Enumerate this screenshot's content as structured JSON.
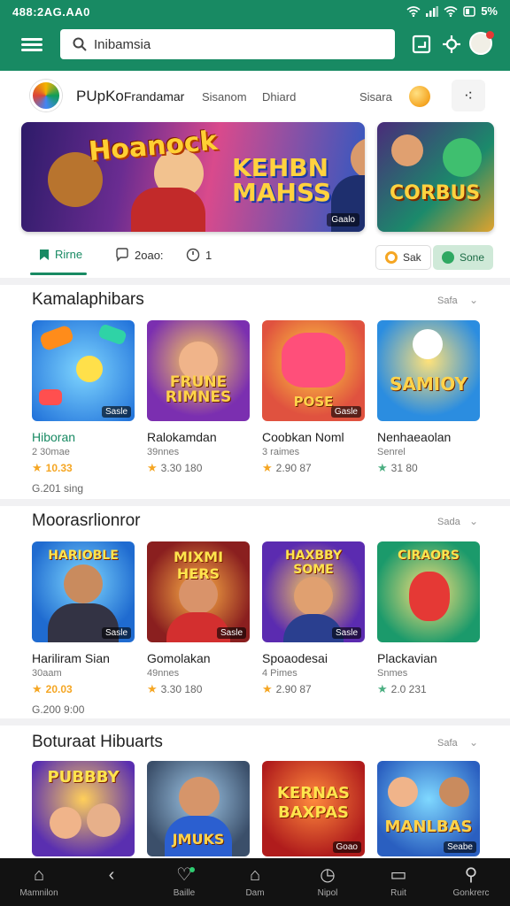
{
  "status_bar": {
    "time": "488:2AG.AA0",
    "battery": "5%"
  },
  "search": {
    "query": "Inibamsia"
  },
  "brand_row": {
    "brand": "PUpKo",
    "nav": [
      "Frandamar",
      "Sisanom",
      "Dhiard",
      "Sisara"
    ]
  },
  "banners": [
    {
      "title_top": "Hoanock",
      "title_main": "KEHBN MAHSS",
      "badge": "Gaalo"
    },
    {
      "title": "CORBUS"
    }
  ],
  "tabs": [
    {
      "label": "Rirne",
      "icon": "bookmark-icon",
      "active": true
    },
    {
      "label": "2oao:",
      "icon": "chat-icon",
      "active": false
    },
    {
      "label": "1",
      "icon": "clock-icon",
      "active": false
    }
  ],
  "chips": [
    {
      "label": "Sak"
    },
    {
      "label": "Sone"
    }
  ],
  "sections": [
    {
      "title": "Kamalaphibars",
      "more": "Safa",
      "cards": [
        {
          "name": "Hiboran",
          "sub": "2 30mae",
          "rating": "10.33",
          "extra": "G.201 sing",
          "badge": "Sasle",
          "art_text": "",
          "art_top": "",
          "name_green": true
        },
        {
          "name": "Ralokamdan",
          "sub": "39nnes",
          "rating": "3.30 180",
          "extra": "",
          "badge": "",
          "art_text": "FRUNE RIMNES",
          "art_top": "",
          "name_green": false
        },
        {
          "name": "Coobkan Noml",
          "sub": "3 raimes",
          "rating": "2.90 87",
          "extra": "",
          "badge": "Gasle",
          "art_text": "POSE",
          "art_top": "",
          "name_green": false
        },
        {
          "name": "Nenhaeaolan",
          "sub": "Senrel",
          "rating": "31 80",
          "extra": "",
          "badge": "",
          "art_text": "SAMIOY",
          "art_top": "",
          "name_green": false
        }
      ]
    },
    {
      "title": "Moorasrlionror",
      "more": "Sada",
      "cards": [
        {
          "name": "Hariliram Sian",
          "sub": "30aam",
          "rating": "20.03",
          "extra": "G.200 9:00",
          "badge": "Sasle",
          "art_text": "",
          "art_top": "HARIOBLE",
          "name_green": false
        },
        {
          "name": "Gomolakan",
          "sub": "49nnes",
          "rating": "3.30 180",
          "extra": "",
          "badge": "Sasle",
          "art_text": "",
          "art_top": "MIXMI HERS",
          "name_green": false
        },
        {
          "name": "Spoaodesai",
          "sub": "4 Pimes",
          "rating": "2.90 87",
          "extra": "",
          "badge": "Sasle",
          "art_text": "",
          "art_top": "HAXBBY SOME",
          "name_green": false
        },
        {
          "name": "Plackavian",
          "sub": "Snmes",
          "rating": "2.0 231",
          "extra": "",
          "badge": "",
          "art_text": "",
          "art_top": "CIRAORS",
          "name_green": false
        }
      ]
    },
    {
      "title": "Boturaat Hibuarts",
      "more": "Safa",
      "cards": [
        {
          "name": "",
          "sub": "",
          "rating": "",
          "extra": "",
          "badge": "",
          "art_text": "",
          "art_top": "PUBBBY",
          "name_green": false
        },
        {
          "name": "",
          "sub": "",
          "rating": "",
          "extra": "",
          "badge": "",
          "art_text": "JMUKS",
          "art_top": "",
          "name_green": false
        },
        {
          "name": "",
          "sub": "",
          "rating": "",
          "extra": "",
          "badge": "Goao",
          "art_text": "",
          "art_top": "KERNAS BAXPAS",
          "name_green": false
        },
        {
          "name": "",
          "sub": "",
          "rating": "",
          "extra": "",
          "badge": "Seabe",
          "art_text": "MANLBAS",
          "art_top": "",
          "name_green": false
        }
      ]
    }
  ],
  "bottom_nav": [
    {
      "label": "Mamnilon",
      "icon": "home-icon"
    },
    {
      "label": "",
      "icon": "back-icon"
    },
    {
      "label": "Baille",
      "icon": "heart-icon"
    },
    {
      "label": "Dam",
      "icon": "house-icon"
    },
    {
      "label": "Nipol",
      "icon": "clock-icon"
    },
    {
      "label": "Ruit",
      "icon": "trash-icon"
    },
    {
      "label": "Gonkrerc",
      "icon": "search-icon"
    }
  ]
}
